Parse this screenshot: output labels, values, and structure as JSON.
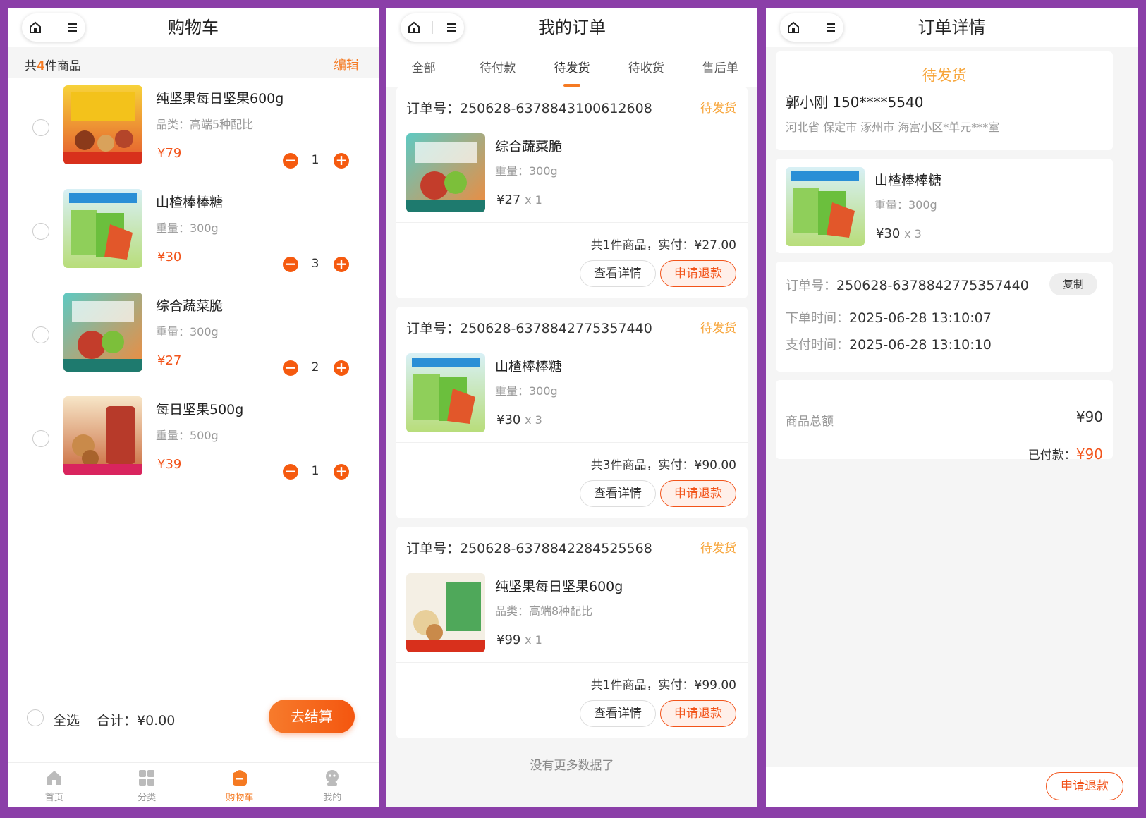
{
  "cart": {
    "title": "购物车",
    "count_prefix": "共",
    "count_num": "4",
    "count_suffix": "件商品",
    "edit_label": "编辑",
    "items": [
      {
        "name": "纯坚果每日坚果600g",
        "spec": "品类：高端5种配比",
        "price": "¥79",
        "qty": "1"
      },
      {
        "name": "山楂棒棒糖",
        "spec": "重量：300g",
        "price": "¥30",
        "qty": "3"
      },
      {
        "name": "综合蔬菜脆",
        "spec": "重量：300g",
        "price": "¥27",
        "qty": "2"
      },
      {
        "name": "每日坚果500g",
        "spec": "重量：500g",
        "price": "¥39",
        "qty": "1"
      }
    ],
    "select_all_label": "全选",
    "total_label": "合计：¥0.00",
    "checkout_label": "去结算",
    "tabs": [
      {
        "label": "首页",
        "icon": "home-icon"
      },
      {
        "label": "分类",
        "icon": "grid-icon"
      },
      {
        "label": "购物车",
        "icon": "cart-icon"
      },
      {
        "label": "我的",
        "icon": "user-icon"
      }
    ]
  },
  "orders": {
    "title": "我的订单",
    "tabs": [
      "全部",
      "待付款",
      "待发货",
      "待收货",
      "售后单"
    ],
    "active_tab": "待发货",
    "list": [
      {
        "order_no": "订单号：250628-6378843100612608",
        "status": "待发货",
        "name": "综合蔬菜脆",
        "spec": "重量：300g",
        "price": "¥27",
        "qty": "x 1",
        "summary": "共1件商品，实付：¥27.00"
      },
      {
        "order_no": "订单号：250628-6378842775357440",
        "status": "待发货",
        "name": "山楂棒棒糖",
        "spec": "重量：300g",
        "price": "¥30",
        "qty": "x 3",
        "summary": "共3件商品，实付：¥90.00"
      },
      {
        "order_no": "订单号：250628-6378842284525568",
        "status": "待发货",
        "name": "纯坚果每日坚果600g",
        "spec": "品类：高端8种配比",
        "price": "¥99",
        "qty": "x 1",
        "summary": "共1件商品，实付：¥99.00"
      }
    ],
    "detail_btn": "查看详情",
    "refund_btn": "申请退款",
    "no_more": "没有更多数据了"
  },
  "detail": {
    "title": "订单详情",
    "status": "待发货",
    "receiver": "郭小刚   150****5540",
    "address": "河北省 保定市 涿州市 海富小区*单元***室",
    "product": {
      "name": "山楂棒棒糖",
      "spec": "重量：300g",
      "price": "¥30",
      "qty": "x 3"
    },
    "order_no_k": "订单号：",
    "order_no_v": "250628-6378842775357440",
    "copy_label": "复制",
    "order_time_k": "下单时间：",
    "order_time_v": "2025-06-28 13:10:07",
    "pay_time_k": "支付时间：",
    "pay_time_v": "2025-06-28 13:10:10",
    "goods_total_k": "商品总额",
    "goods_total_v": "¥90",
    "paid_k": "已付款：",
    "paid_v": "¥90",
    "refund_btn": "申请退款"
  },
  "colors": {
    "accent": "#f57a22",
    "price": "#f2541b",
    "status": "#f7a53a",
    "frame": "#8b3fa8"
  }
}
